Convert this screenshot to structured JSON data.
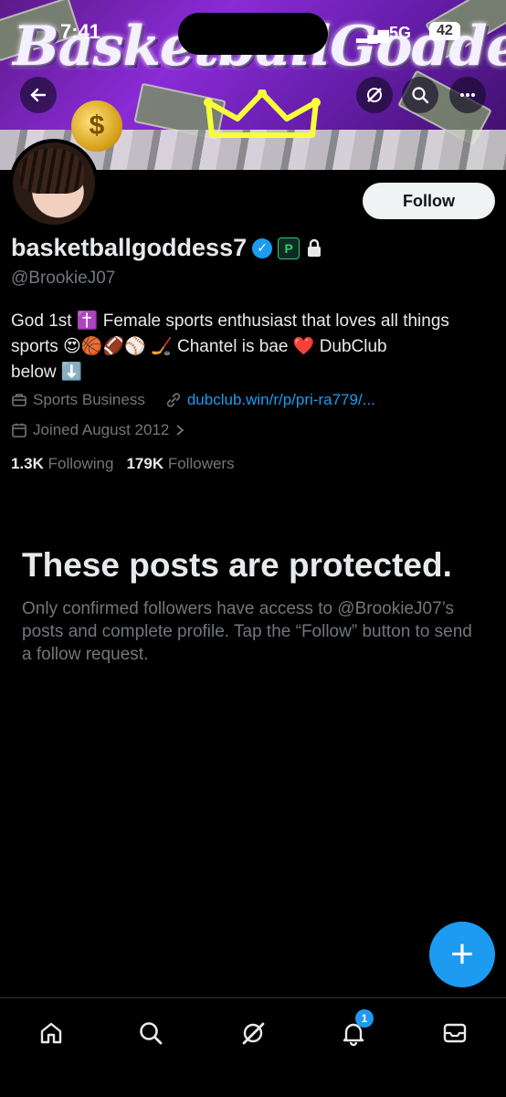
{
  "status_bar": {
    "time": "7:41",
    "network": "5G",
    "battery": "42"
  },
  "banner": {
    "title_art": "BasketballGoddess",
    "coin_symbol": "$"
  },
  "profile": {
    "display_name": "basketballgoddess7",
    "handle": "@BrookieJ07",
    "follow_label": "Follow",
    "bio_line1": "God 1st ✝️ Female sports enthusiast that loves all things",
    "bio_line2": "sports 😍🏀🏈⚾️ 🏒 Chantel is bae ❤️ DubClub",
    "bio_line3": "below ⬇️",
    "category": "Sports Business",
    "website": "dubclub.win/r/p/pri-ra779/...",
    "joined": "Joined August 2012",
    "following_count": "1.3K",
    "following_label": "Following",
    "followers_count": "179K",
    "followers_label": "Followers"
  },
  "protected": {
    "title": "These posts are protected.",
    "body": "Only confirmed followers have access to @BrookieJ07’s posts and complete profile. Tap the “Follow” button to send a follow request."
  },
  "fab": {
    "symbol": "+"
  },
  "nav": {
    "notification_count": "1"
  },
  "colors": {
    "accent": "#1d9bf0",
    "background": "#000000",
    "muted": "#71767b",
    "text": "#e7e9ea"
  }
}
